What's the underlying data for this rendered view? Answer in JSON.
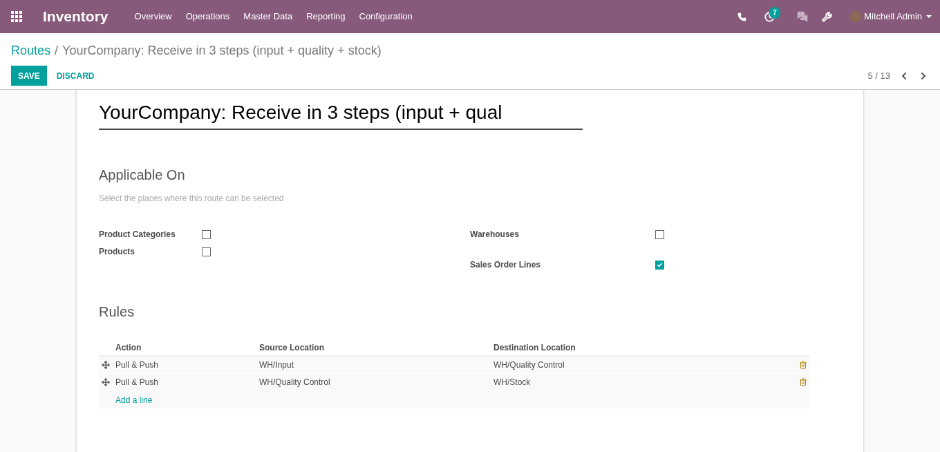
{
  "navbar": {
    "app_title": "Inventory",
    "menu": [
      "Overview",
      "Operations",
      "Master Data",
      "Reporting",
      "Configuration"
    ],
    "activity_count": "7",
    "user": "Mitchell Admin"
  },
  "breadcrumb": {
    "parent": "Routes",
    "separator": "/",
    "current": "YourCompany: Receive in 3 steps (input + quality + stock)"
  },
  "buttons": {
    "save": "SAVE",
    "discard": "DISCARD"
  },
  "pager": "5 / 13",
  "form": {
    "name_value": "YourCompany: Receive in 3 steps (input + qual",
    "applicable_on": {
      "title": "Applicable On",
      "hint": "Select the places where this route can be selected",
      "left": [
        {
          "label": "Product Categories",
          "checked": false
        },
        {
          "label": "Products",
          "checked": false
        }
      ],
      "right": [
        {
          "label": "Warehouses",
          "checked": false
        },
        {
          "label": "Sales Order Lines",
          "checked": true
        }
      ]
    },
    "rules": {
      "title": "Rules",
      "columns": [
        "Action",
        "Source Location",
        "Destination Location"
      ],
      "rows": [
        {
          "action": "Pull & Push",
          "source": "WH/Input",
          "destination": "WH/Quality Control"
        },
        {
          "action": "Pull & Push",
          "source": "WH/Quality Control",
          "destination": "WH/Stock"
        }
      ],
      "add_line": "Add a line"
    }
  }
}
